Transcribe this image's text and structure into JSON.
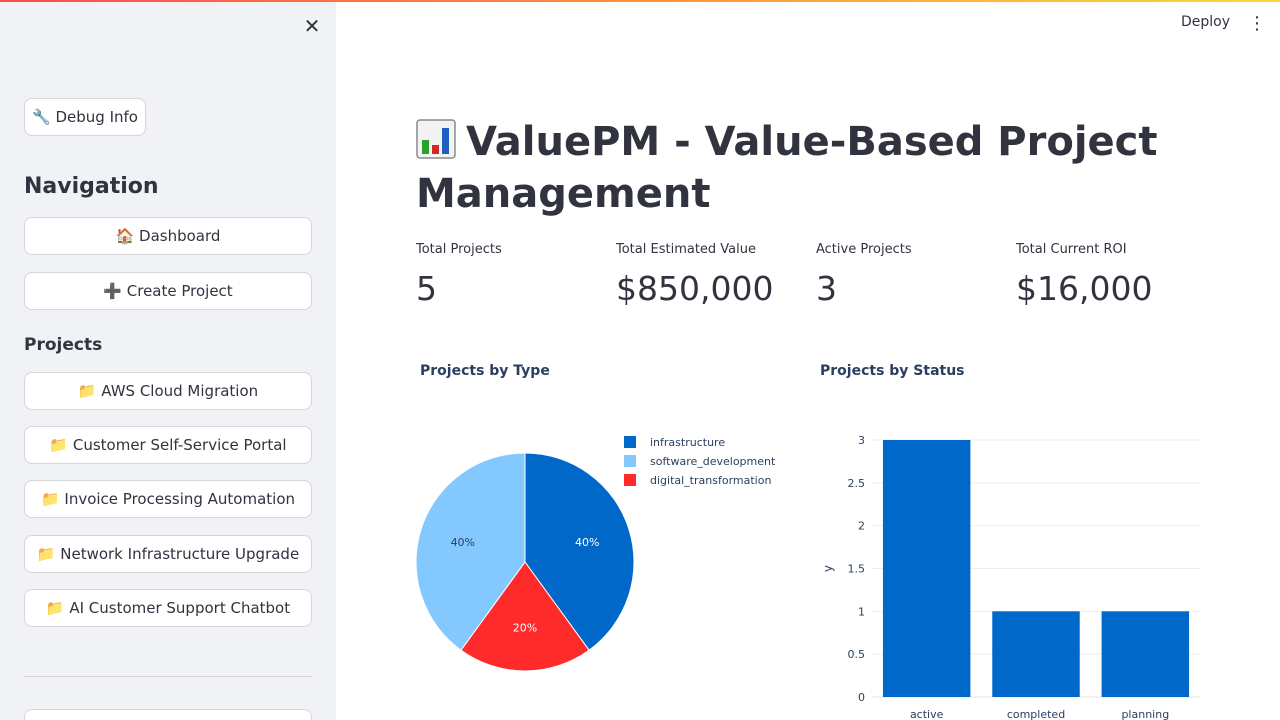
{
  "sidebar": {
    "debug_button": "🔧 Debug Info",
    "navigation_heading": "Navigation",
    "nav": [
      {
        "label": "🏠 Dashboard"
      },
      {
        "label": "➕ Create Project"
      }
    ],
    "projects_heading": "Projects",
    "projects": [
      {
        "label": "📁 AWS Cloud Migration"
      },
      {
        "label": "📁 Customer Self-Service Portal"
      },
      {
        "label": "📁 Invoice Processing Automation"
      },
      {
        "label": "📁 Network Infrastructure Upgrade"
      },
      {
        "label": "📁 AI Customer Support Chatbot"
      }
    ]
  },
  "header": {
    "deploy_label": "Deploy",
    "menu_icon": "⋮"
  },
  "main": {
    "title": "ValuePM - Value-Based Project Management",
    "title_icon": "bar-chart-icon",
    "metrics": [
      {
        "label": "Total Projects",
        "value": "5"
      },
      {
        "label": "Total Estimated Value",
        "value": "$850,000"
      },
      {
        "label": "Active Projects",
        "value": "3"
      },
      {
        "label": "Total Current ROI",
        "value": "$16,000"
      }
    ]
  },
  "chart_data": [
    {
      "type": "pie",
      "title": "Projects by Type",
      "labels": [
        "infrastructure",
        "software_development",
        "digital_transformation"
      ],
      "values": [
        2,
        2,
        1
      ],
      "percent_labels": [
        "40%",
        "40%",
        "20%"
      ],
      "colors": [
        "#0068c9",
        "#83c9ff",
        "#ff2b2b"
      ],
      "legend": "right"
    },
    {
      "type": "bar",
      "title": "Projects by Status",
      "categories": [
        "active",
        "completed",
        "planning"
      ],
      "values": [
        3,
        1,
        1
      ],
      "ylabel": "y",
      "xlabel": "",
      "ylim": [
        0,
        3
      ],
      "yticks": [
        "0",
        "0.5",
        "1",
        "1.5",
        "2",
        "2.5",
        "3"
      ],
      "grid": true,
      "color": "#0068c9"
    }
  ]
}
